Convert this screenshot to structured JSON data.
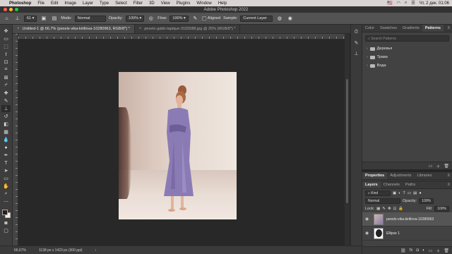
{
  "menubar": {
    "apple": "",
    "items": [
      "Photoshop",
      "File",
      "Edit",
      "Image",
      "Layer",
      "Type",
      "Select",
      "Filter",
      "3D",
      "View",
      "Plugins",
      "Window",
      "Help"
    ],
    "clock": "Чт, 2 дек.  01:06"
  },
  "window": {
    "title": "Adobe Photoshop 2022"
  },
  "options": {
    "brush_size": "61",
    "mode_label": "Mode:",
    "mode_value": "Normal",
    "opacity_label": "Opacity:",
    "opacity_value": "100%",
    "flow_label": "Flow:",
    "flow_value": "100%",
    "aligned_label": "Aligned",
    "sample_label": "Sample:",
    "sample_value": "Current Layer"
  },
  "tabs": [
    {
      "label": "Untitled-1 @ 66,7% (pexels-vika-kirillova-10280963, RGB/8*) *"
    },
    {
      "label": "pexels-gabb-tapique-3155588.jpg @ 25% (RGB/8*) *"
    }
  ],
  "status": {
    "zoom": "66,67%",
    "doc_size": "1138 px x 1423 px (300 ppi)"
  },
  "patterns_panel": {
    "tabs": [
      "Color",
      "Swatches",
      "Gradients",
      "Patterns"
    ],
    "search_placeholder": "Search Patterns",
    "folders": [
      "Деревья",
      "Трава",
      "Вода"
    ]
  },
  "props_panel": {
    "tabs": [
      "Properties",
      "Adjustments",
      "Libraries"
    ]
  },
  "layers_panel": {
    "tabs": [
      "Layers",
      "Channels",
      "Paths"
    ],
    "kind_label": "Kind",
    "blend_mode": "Normal",
    "opacity_label": "Opacity:",
    "opacity_value": "100%",
    "lock_label": "Lock:",
    "fill_label": "Fill:",
    "fill_value": "100%",
    "layers": [
      {
        "name": "pexels-vika-kirillova-10280963"
      },
      {
        "name": "Ellipse 1"
      }
    ]
  }
}
